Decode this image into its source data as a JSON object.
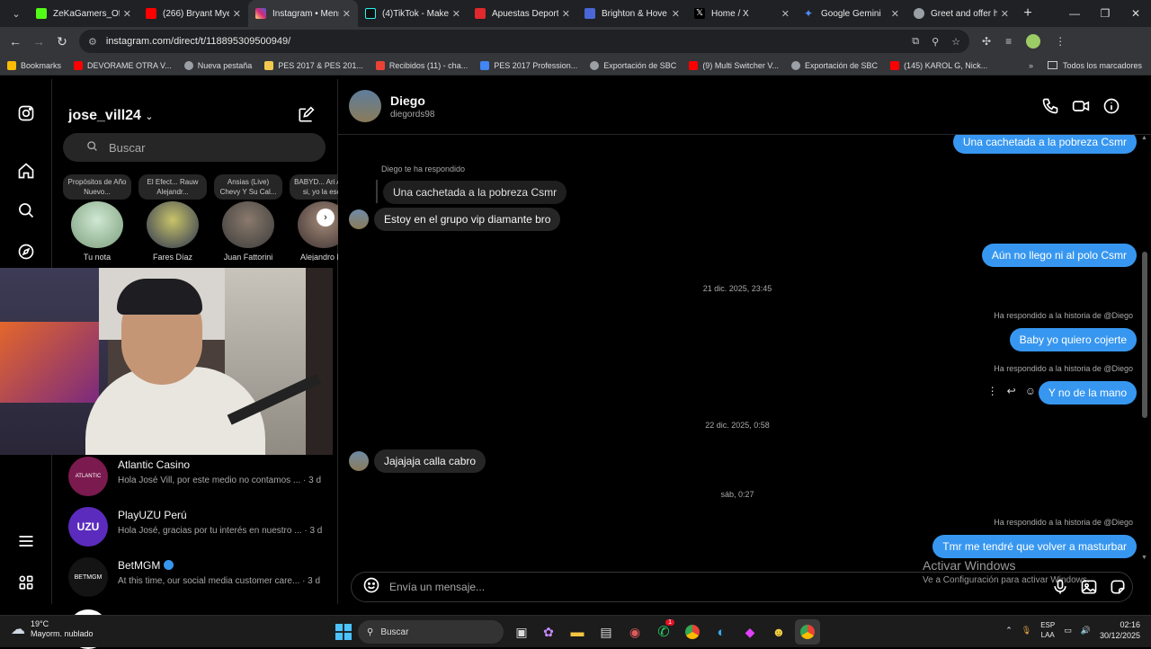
{
  "browser": {
    "tabs": [
      {
        "title": "ZeKaGamers_Ofic",
        "color": "#53fc18"
      },
      {
        "title": "(266) Bryant Myer",
        "color": "#ff0000"
      },
      {
        "title": "Instagram • Mens",
        "color": "#d62976",
        "active": true
      },
      {
        "title": "(4)TikTok - Make",
        "color": "#111111"
      },
      {
        "title": "Apuestas Deporti",
        "color": "#e0282d"
      },
      {
        "title": "Brighton & Hove",
        "color": "#4a66d9"
      },
      {
        "title": "Home / X",
        "color": "#000000"
      },
      {
        "title": "Google Gemini",
        "color": "#4f8cf7"
      },
      {
        "title": "Greet and offer h",
        "color": "#9aa0a6"
      }
    ],
    "url": "instagram.com/direct/t/118895309500949/",
    "bookmarks": [
      {
        "label": "Bookmarks",
        "color": "#fbbc04"
      },
      {
        "label": "DEVORAME OTRA V...",
        "color": "#ff0000"
      },
      {
        "label": "Nueva pestaña",
        "color": "#9aa0a6"
      },
      {
        "label": "PES 2017 & PES 201...",
        "color": "#f2c94c"
      },
      {
        "label": "Recibidos (11) - cha...",
        "color": "#ea4335"
      },
      {
        "label": "PES 2017 Profession...",
        "color": "#4285f4"
      },
      {
        "label": "Exportación de SBC",
        "color": "#9aa0a6"
      },
      {
        "label": "(9) Multi Switcher V...",
        "color": "#ff0000"
      },
      {
        "label": "Exportación de SBC",
        "color": "#9aa0a6"
      },
      {
        "label": "(145) KAROL G, Nick...",
        "color": "#ff0000"
      }
    ],
    "bookmarks_more": "»",
    "all_bookmarks": "Todos los marcadores"
  },
  "inbox": {
    "username": "jose_vill24",
    "search_placeholder": "Buscar",
    "notes": [
      {
        "bubble": "Propósitos de Año Nuevo...",
        "name": "Tu nota"
      },
      {
        "bubble": "El Efect... Rauw Alejandr...",
        "name": "Fares Díaz"
      },
      {
        "bubble": "Ansias (Live) Chevy Y Su Cal...",
        "name": "Juan Fattorini"
      },
      {
        "bubble": "BABYD... Ari Abdu si, yo la escu",
        "name": "Alejandro Ra"
      }
    ],
    "conversations": [
      {
        "name": "Atlantic Casino",
        "preview": "Hola José Vill, por este medio no contamos ... · 3 d",
        "color": "#7a1a4e"
      },
      {
        "name": "PlayUZU Perú",
        "preview": "Hola José, gracias por tu interés en nuestro ... · 3 d",
        "color": "#5b2bbd"
      },
      {
        "name": "BetMGM",
        "preview": "At this time, our social media customer care... · 3 d",
        "color": "#141414"
      }
    ]
  },
  "chat": {
    "name": "Diego",
    "handle": "diegords98",
    "messages": {
      "out1": "Una cachetada a la pobreza Csmr",
      "reply_note": "Diego te ha respondido",
      "quoted": "Una cachetada a la pobreza Csmr",
      "in1": "Estoy en el grupo vip diamante bro",
      "out2": "Aún no llego ni al polo Csmr",
      "ts1": "21 dic. 2025, 23:45",
      "story1": "Ha respondido a la historia de @Diego",
      "out3": "Baby yo quiero cojerte",
      "story2": "Ha respondido a la historia de @Diego",
      "out4": "Y no de la mano",
      "ts2": "22 dic. 2025, 0:58",
      "in2": "Jajajaja calla cabro",
      "ts3": "sáb, 0:27",
      "story3": "Ha respondido a la historia de @Diego",
      "out5": "Tmr me tendré que volver a masturbar"
    },
    "composer_placeholder": "Envía un mensaje...",
    "watermark_title": "Activar Windows",
    "watermark_sub": "Ve a Configuración para activar Windows."
  },
  "taskbar": {
    "temperature": "19°C",
    "weather": "Mayorm. nublado",
    "search": "Buscar",
    "lang_top": "ESP",
    "lang_bottom": "LAA",
    "time": "02:16",
    "date": "30/12/2025",
    "whatsapp_badge": "1"
  }
}
